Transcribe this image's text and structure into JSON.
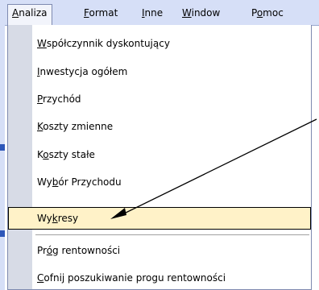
{
  "menubar": {
    "items": [
      {
        "pre": "",
        "key": "A",
        "post": "naliza"
      },
      {
        "pre": "",
        "key": "F",
        "post": "ormat"
      },
      {
        "pre": "",
        "key": "I",
        "post": "nne"
      },
      {
        "pre": "",
        "key": "W",
        "post": "indow"
      },
      {
        "pre": "P",
        "key": "o",
        "post": "moc"
      }
    ]
  },
  "menu": {
    "items": [
      {
        "pre": "",
        "key": "W",
        "post": "spółczynnik dyskontujący"
      },
      {
        "pre": "",
        "key": "I",
        "post": "nwestycja ogółem"
      },
      {
        "pre": "",
        "key": "P",
        "post": "rzychód"
      },
      {
        "pre": "",
        "key": "K",
        "post": "oszty zmienne"
      },
      {
        "pre": "K",
        "key": "o",
        "post": "szty stałe"
      },
      {
        "pre": "Wy",
        "key": "b",
        "post": "ór Przychodu"
      },
      {
        "pre": "Wy",
        "key": "k",
        "post": "resy"
      },
      {
        "pre": "Pr",
        "key": "ó",
        "post": "g rentowności"
      },
      {
        "pre": "",
        "key": "C",
        "post": "ofnij poszukiwanie progu rentowności"
      }
    ]
  },
  "colors": {
    "highlight": "#fff2c8",
    "menubar": "#d6dff7",
    "gutter": "#d7dbe6"
  }
}
